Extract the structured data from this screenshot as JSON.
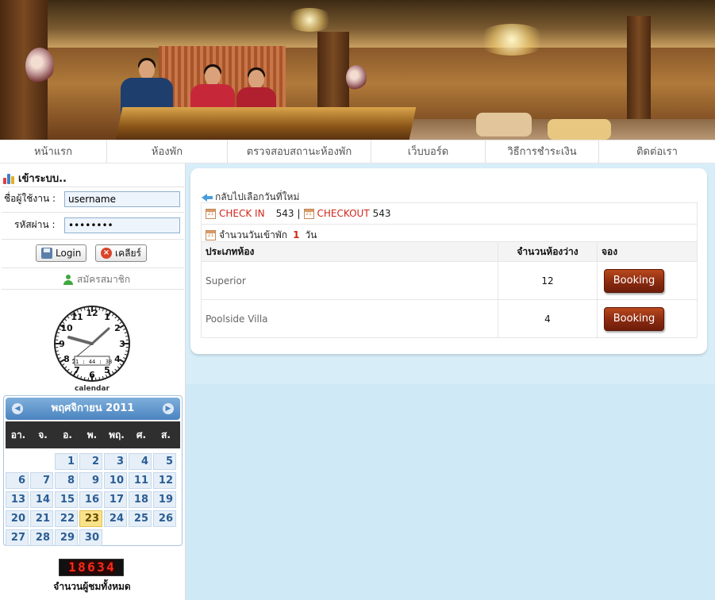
{
  "nav": {
    "items": [
      {
        "label": "หน้าแรก"
      },
      {
        "label": "ห้องพัก"
      },
      {
        "label": "ตรวจสอบสถานะห้องพัก"
      },
      {
        "label": "เว็บบอร์ด"
      },
      {
        "label": "วิธีการชำระเงิน"
      },
      {
        "label": "ติดต่อเรา"
      }
    ]
  },
  "login": {
    "title": "เข้าระบบ..",
    "username_label": "ชื่อผู้ใช้งาน :",
    "username_value": "username",
    "password_label": "รหัสผ่าน :",
    "password_value": "password",
    "login_button": "Login",
    "clear_button": "เคลียร์",
    "register_link": "สมัครสมาชิก"
  },
  "clock": {
    "digital_time": "21 : 44 : 38",
    "caption": "calendar"
  },
  "calendar": {
    "month_label": "พฤศจิกายน 2011",
    "weekdays": [
      "อา.",
      "จ.",
      "อ.",
      "พ.",
      "พฤ.",
      "ศ.",
      "ส."
    ],
    "today": "23",
    "weeks": [
      [
        "",
        "",
        "1",
        "2",
        "3",
        "4",
        "5"
      ],
      [
        "6",
        "7",
        "8",
        "9",
        "10",
        "11",
        "12"
      ],
      [
        "13",
        "14",
        "15",
        "16",
        "17",
        "18",
        "19"
      ],
      [
        "20",
        "21",
        "22",
        "23",
        "24",
        "25",
        "26"
      ],
      [
        "27",
        "28",
        "29",
        "30",
        "",
        "",
        ""
      ]
    ]
  },
  "visitor_counter": {
    "digits": "18634",
    "label": "จำนวนผู้ชมทั้งหมด"
  },
  "booking": {
    "back_link": "กลับไปเลือกวันที่ใหม่",
    "checkin_label": "CHECK IN",
    "checkin_value": "543",
    "separator": "|",
    "checkout_label": "CHECKOUT",
    "checkout_value": "543",
    "nights_prefix": "จำนวนวันเข้าพัก",
    "nights_value": "1",
    "nights_suffix": "วัน",
    "table_headers": [
      "ประเภทห้อง",
      "จำนวนห้องว่าง",
      "จอง"
    ],
    "rooms": [
      {
        "type": "Superior",
        "available": "12",
        "button": "Booking"
      },
      {
        "type": "Poolside Villa",
        "available": "4",
        "button": "Booking"
      }
    ]
  },
  "colors": {
    "accent_blue": "#4a83bf",
    "booking_button": "#8a2a10",
    "content_bg": "#cfe9f7",
    "today_highlight": "#f9e38a",
    "counter_red": "#ff2a1a"
  }
}
